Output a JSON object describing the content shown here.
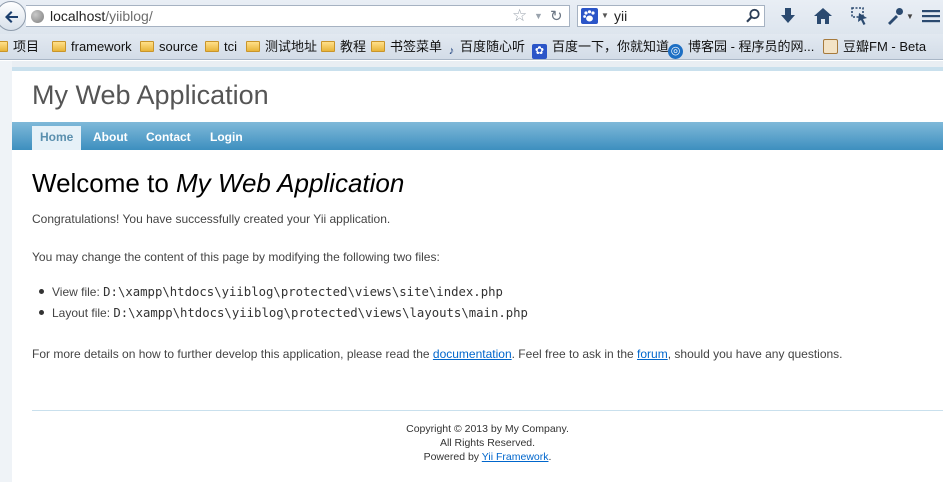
{
  "browser": {
    "url_host": "localhost",
    "url_path": "/yiiblog/",
    "search_query": "yii",
    "bookmarks": [
      {
        "label": "项目",
        "icon": "folder-icon"
      },
      {
        "label": "framework",
        "icon": "folder-icon"
      },
      {
        "label": "source",
        "icon": "folder-icon"
      },
      {
        "label": "tci",
        "icon": "folder-icon"
      },
      {
        "label": "测试地址",
        "icon": "folder-icon"
      },
      {
        "label": "教程",
        "icon": "folder-icon"
      },
      {
        "label": "书签菜单",
        "icon": "folder-icon"
      },
      {
        "label": "百度随心听",
        "icon": "music-note-icon"
      },
      {
        "label": "百度一下，你就知道",
        "icon": "baidu-paw-icon"
      },
      {
        "label": "博客园 - 程序员的网...",
        "icon": "cnblogs-icon"
      },
      {
        "label": "豆瓣FM - Beta",
        "icon": "doubanfm-icon"
      }
    ]
  },
  "site": {
    "logo": "My Web Application",
    "menu": [
      {
        "label": "Home",
        "active": true
      },
      {
        "label": "About",
        "active": false
      },
      {
        "label": "Contact",
        "active": false
      },
      {
        "label": "Login",
        "active": false
      }
    ]
  },
  "content": {
    "heading_prefix": "Welcome to ",
    "heading_app": "My Web Application",
    "congrats": "Congratulations! You have successfully created your Yii application.",
    "modify_intro": "You may change the content of this page by modifying the following two files:",
    "files": [
      {
        "label": "View file: ",
        "path": "D:\\xampp\\htdocs\\yiiblog\\protected\\views\\site\\index.php"
      },
      {
        "label": "Layout file: ",
        "path": "D:\\xampp\\htdocs\\yiiblog\\protected\\views\\layouts\\main.php"
      }
    ],
    "details_1": "For more details on how to further develop this application, please read the ",
    "details_link_1": "documentation",
    "details_2": ". Feel free to ask in the ",
    "details_link_2": "forum",
    "details_3": ", should you have any questions."
  },
  "footer": {
    "copyright": "Copyright © 2013 by My Company.",
    "rights": "All Rights Reserved.",
    "powered_prefix": "Powered by ",
    "powered_link": "Yii Framework",
    "powered_suffix": "."
  }
}
